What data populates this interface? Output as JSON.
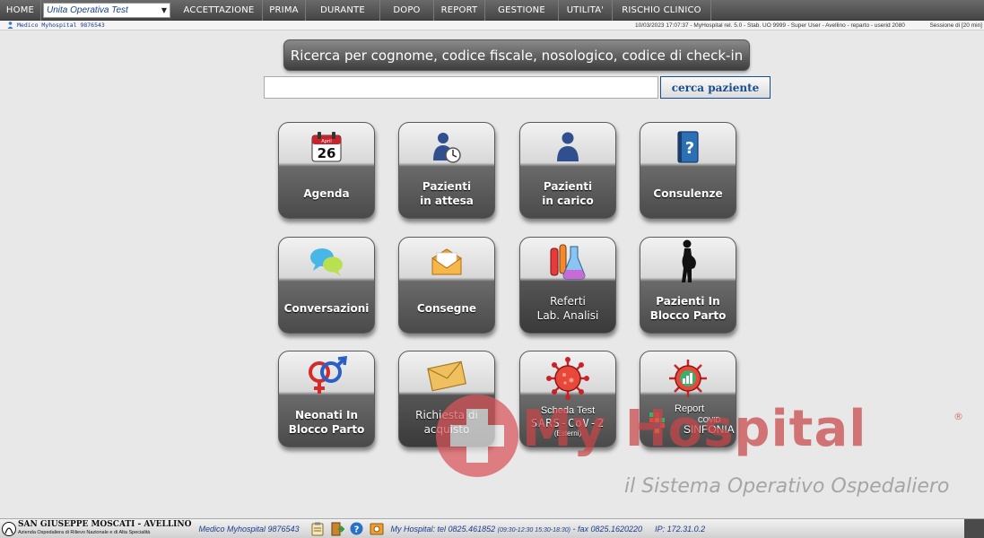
{
  "nav": {
    "home": "HOME",
    "unit_select": "Unita Operativa Test",
    "items": [
      "ACCETTAZIONE",
      "PRIMA",
      "DURANTE",
      "DOPO",
      "REPORT",
      "GESTIONE",
      "UTILITA'",
      "RISCHIO CLINICO"
    ]
  },
  "status": {
    "user": "Medico Myhospital 9876543",
    "info": "10/03/2023 17:07:37 - MyHospital rel. 5.0 - Stab. UO 9999 - Super User - Avellino - reparto - userid 2080",
    "session": "Sessione di [20 min]"
  },
  "search": {
    "title": "Ricerca per cognome, codice fiscale, nosologico, codice di check-in",
    "placeholder": "",
    "button": "cerca paziente"
  },
  "tiles": {
    "agenda": {
      "label": "Agenda",
      "date": "26",
      "month": "April"
    },
    "pazienti_attesa": {
      "label": "Pazienti\nin attesa"
    },
    "pazienti_carico": {
      "label": "Pazienti\nin carico"
    },
    "consulenze": {
      "label": "Consulenze"
    },
    "conversazioni": {
      "label": "Conversazioni"
    },
    "consegne": {
      "label": "Consegne"
    },
    "referti": {
      "label": "Referti\nLab. Analisi"
    },
    "blocco_parto": {
      "label": "Pazienti In\nBlocco Parto"
    },
    "neonati": {
      "label": "Neonati In\nBlocco Parto"
    },
    "richiesta": {
      "label": "Richiesta di\nacquisto"
    },
    "scheda_test": {
      "line1": "Scheda Test",
      "line2": "SARS-CoV-2",
      "line3": "(Esterni)"
    },
    "report_covid": {
      "line1": "Report",
      "line2": "COVID",
      "line3": "SINFONIA"
    }
  },
  "watermark": {
    "title": "My Hospital",
    "reg": "®",
    "subtitle": "il Sistema Operativo Ospedaliero"
  },
  "footer": {
    "hospital_name": "SAN GIUSEPPE MOSCATI - AVELLINO",
    "hospital_sub": "Azienda Ospedaliera di Rilievo Nazionale e di Alta Specialità",
    "user": "Medico Myhospital 9876543",
    "contact_prefix": "My Hospital: tel 0825.461852",
    "contact_hours": "(09:30-12:30 15:30-18:30)",
    "contact_fax": "- fax 0825.1620220",
    "ip": "IP: 172.31.0.2"
  },
  "colors": {
    "accent": "#1a3d8f",
    "brand_red": "#c9474a"
  }
}
